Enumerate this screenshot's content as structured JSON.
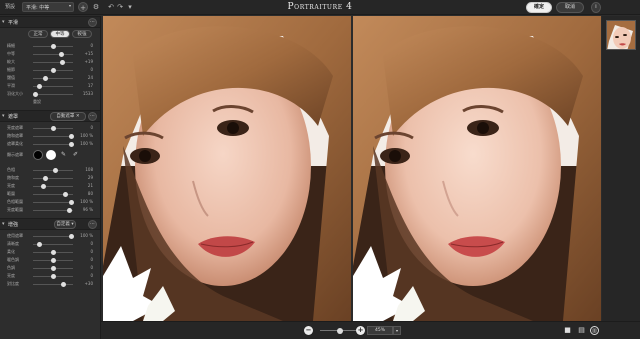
{
  "app": {
    "title": "Portraiture 4"
  },
  "topbar": {
    "preset_label": "預設",
    "preset_value": "平滑: 中等",
    "ok_label": "確定",
    "cancel_label": "取消",
    "info_label": "i"
  },
  "smoothing": {
    "title": "平滑",
    "tabs": [
      {
        "label": "正常",
        "active": false
      },
      {
        "label": "中等",
        "active": true
      },
      {
        "label": "較強",
        "active": false
      }
    ],
    "sliders": [
      {
        "label": "精細",
        "value": "0",
        "fraction": 0.5
      },
      {
        "label": "中等",
        "value": "+15",
        "fraction": 0.7
      },
      {
        "label": "較大",
        "value": "+19",
        "fraction": 0.74
      },
      {
        "label": "細節",
        "value": "0",
        "fraction": 0.5
      },
      {
        "label": "閾值",
        "value": "24",
        "fraction": 0.3
      },
      {
        "label": "平滑",
        "value": "17",
        "fraction": 0.17
      },
      {
        "label": "羽化大小",
        "value": "1533",
        "fraction": 0.05
      }
    ],
    "reset_label": "重設"
  },
  "mask": {
    "title": "遮罩",
    "auto_label": "自動遮罩 ✕",
    "sliders": [
      {
        "label": "亮度遮罩",
        "value": "0",
        "fraction": 0.5
      },
      {
        "label": "飽和遮罩",
        "value": "100 %",
        "fraction": 0.95
      },
      {
        "label": "遮罩柔化",
        "value": "100 %",
        "fraction": 0.95
      }
    ],
    "preview_label": "顯示遮罩",
    "color_sliders": [
      {
        "label": "色相",
        "value": "108",
        "fraction": 0.55
      },
      {
        "label": "飽和度",
        "value": "29",
        "fraction": 0.3
      },
      {
        "label": "亮度",
        "value": "21",
        "fraction": 0.25
      },
      {
        "label": "範圍",
        "value": "80",
        "fraction": 0.8
      },
      {
        "label": "色相範圍",
        "value": "100 %",
        "fraction": 0.95
      },
      {
        "label": "亮度範圍",
        "value": "96 %",
        "fraction": 0.92
      }
    ]
  },
  "enhance": {
    "title": "增強",
    "mode_label": "自定義 ▾",
    "sliders": [
      {
        "label": "使用遮罩",
        "value": "100 %",
        "fraction": 0.95
      },
      {
        "label": "清晰度",
        "value": "0",
        "fraction": 0.15
      },
      {
        "label": "柔化",
        "value": "0",
        "fraction": 0.5
      },
      {
        "label": "暖色調",
        "value": "0",
        "fraction": 0.5
      },
      {
        "label": "色調",
        "value": "0",
        "fraction": 0.5
      },
      {
        "label": "亮度",
        "value": "0",
        "fraction": 0.5
      },
      {
        "label": "對比度",
        "value": "+30",
        "fraction": 0.75
      }
    ]
  },
  "bottombar": {
    "zoom_value": "45%",
    "zoom_fraction": 0.55
  },
  "colors": {
    "panel": "#2d2d2d",
    "topbar": "#262626",
    "swatch_black": "#000000",
    "swatch_white": "#ffffff"
  }
}
